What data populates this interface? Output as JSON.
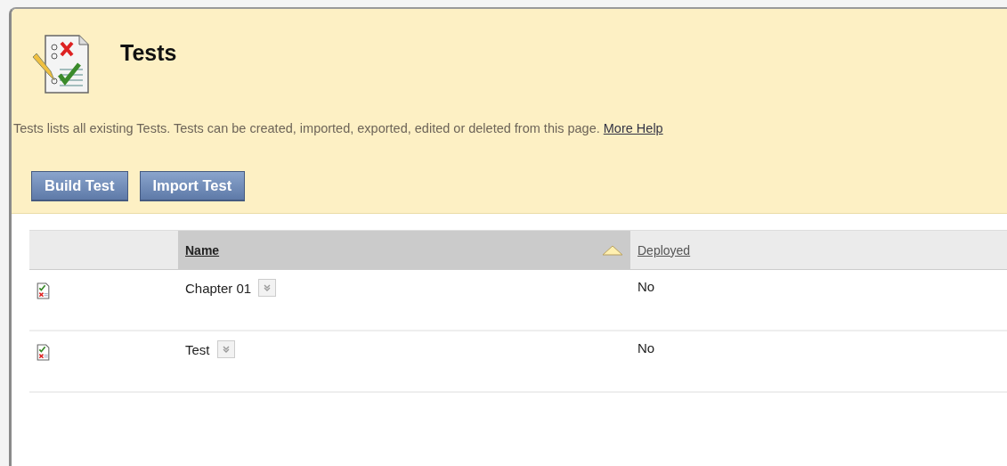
{
  "page": {
    "title": "Tests",
    "description": "Tests lists all existing Tests. Tests can be created, imported, exported, edited or deleted from this page.",
    "help_link": "More Help"
  },
  "buttons": [
    "Build Test",
    "Import Test"
  ],
  "table": {
    "columns": [
      {
        "label": "Name",
        "sorted": true
      },
      {
        "label": "Deployed",
        "sorted": false
      }
    ],
    "rows": [
      {
        "name": "Chapter 01",
        "deployed": "No"
      },
      {
        "name": "Test",
        "deployed": "No"
      }
    ]
  }
}
